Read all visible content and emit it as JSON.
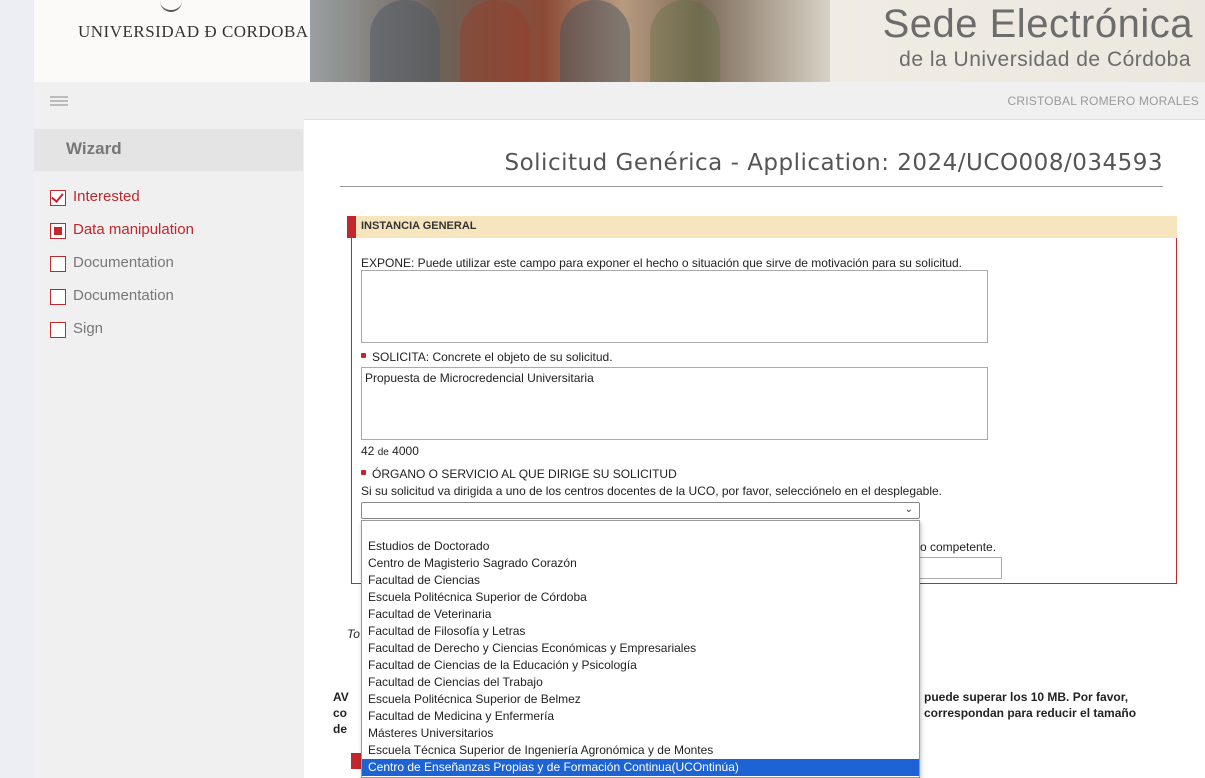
{
  "header": {
    "logo_text": "UNIVERSIDAD Ð CORDOBA",
    "site_title": "Sede Electrónica",
    "site_subtitle": "de la Universidad de Córdoba"
  },
  "topbar": {
    "user_name": "CRISTOBAL ROMERO MORALES"
  },
  "sidebar": {
    "title": "Wizard",
    "steps": [
      {
        "label": "Interested",
        "state": "checked"
      },
      {
        "label": "Data manipulation",
        "state": "current"
      },
      {
        "label": "Documentation",
        "state": "empty"
      },
      {
        "label": "Documentation",
        "state": "empty"
      },
      {
        "label": "Sign",
        "state": "empty"
      }
    ]
  },
  "main": {
    "title": "Solicitud Genérica - Application: 2024/UCO008/034593",
    "section_title": "INSTANCIA GENERAL",
    "expone_label": "EXPONE: Puede utilizar este campo para exponer el hecho o situación que sirve de motivación para su solicitud.",
    "expone_value": "",
    "solicita_label": "SOLICITA: Concrete el objeto de su solicitud.",
    "solicita_value": "Propuesta de Microcredencial Universitaria",
    "char_count": "42",
    "char_sep": "de",
    "char_max": "4000",
    "organo_label": "ÓRGANO O SERVICIO AL QUE DIRIGE SU SOLICITUD",
    "organo_help": "Si su solicitud va dirigida a uno de los centros docentes de la UCO, por favor, selecciónelo en el desplegable.",
    "organo_selected": "",
    "competente_fragment": "o competente.",
    "to_fragment": "To",
    "aviso_prefix": "AV",
    "co_prefix": "co",
    "de_prefix": "de",
    "aviso_right_1": "puede superar los 10 MB. Por favor,",
    "aviso_right_2": "correspondan para reducir el tamaño"
  },
  "dropdown": {
    "options": [
      "",
      "Estudios de Doctorado",
      "Centro de Magisterio Sagrado Corazón",
      "Facultad de Ciencias",
      "Escuela Politécnica Superior de Córdoba",
      "Facultad de Veterinaria",
      "Facultad de Filosofía y Letras",
      "Facultad de Derecho y Ciencias Económicas y Empresariales",
      "Facultad de Ciencias de la Educación y Psicología",
      "Facultad de Ciencias del Trabajo",
      "Escuela Politécnica Superior de Belmez",
      "Facultad de Medicina y Enfermería",
      "Másteres Universitarios",
      "Escuela Técnica Superior de Ingeniería Agronómica y de Montes",
      "Centro de Enseñanzas Propias y de Formación Continua(UCOntinúa)"
    ],
    "highlighted": "Centro de Enseñanzas Propias y de Formación Continua(UCOntinúa)"
  },
  "colors": {
    "accent": "#c1272d",
    "section_bg": "#f7e6bd",
    "highlight": "#1e63d3"
  }
}
